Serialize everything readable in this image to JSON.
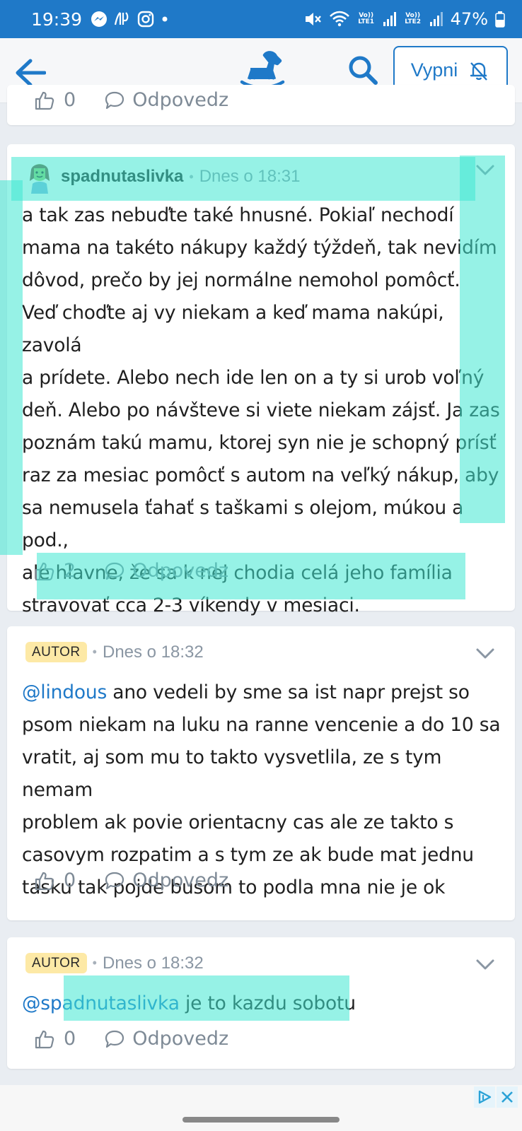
{
  "status_bar": {
    "time": "19:39",
    "network1": "Vo)) LTE1",
    "network2": "Vo)) LTE2",
    "battery": "47%"
  },
  "app_bar": {
    "mute_button_label": "Vypni"
  },
  "top_card": {
    "like_count": "0",
    "reply_label": "Odpovedz"
  },
  "comments": [
    {
      "username": "spadnutaslivka",
      "time": "Dnes o 18:31",
      "lines": [
        "a tak zas nebuďte také hnusné. Pokiaľ nechodí",
        "mama na takéto nákupy každý týždeň, tak nevidím",
        "dôvod, prečo by jej normálne nemohol pomôcť.",
        "Veď choďte aj vy niekam a keď mama nakúpi, zavolá",
        "a prídete. Alebo nech ide len on a ty si urob voľný",
        "deň. Alebo po návšteve si viete niekam zájsť. Ja zas",
        "poznám takú mamu, ktorej syn nie je schopný prísť",
        "raz za mesiac pomôcť s autom na veľký nákup, aby",
        "sa nemusela ťahať s taškami s olejom, múkou a pod.,",
        "ale hlavne, že sa k nej chodia celá jeho família",
        "stravovať cca 2-3 víkendy v mesiaci."
      ],
      "likes": "2",
      "reply_label": "Odpovedz"
    },
    {
      "badge": "AUTOR",
      "time": "Dnes o 18:32",
      "mention": "@lindous",
      "first_line_rest": " ano vedeli by sme sa ist napr prejst so",
      "lines": [
        "psom niekam na luku na ranne vencenie a do 10 sa",
        "vratit, aj som mu to takto vysvetlila, ze s tym nemam",
        "problem ak povie orientacny cas ale ze takto s",
        "casovym rozpatim a s tym ze ak bude mat jednu",
        "tasku tak pojde busom to podla mna nie je ok"
      ],
      "likes": "0",
      "reply_label": "Odpovedz"
    },
    {
      "badge": "AUTOR",
      "time": "Dnes o 18:32",
      "mention": "@spadnutaslivka",
      "text": " je to kazdu sobotu",
      "likes": "0",
      "reply_label": "Odpovedz"
    }
  ],
  "colors": {
    "brand_blue": "#1f79c8",
    "highlight": "#40e8d2",
    "autor_badge": "#fde9a6"
  }
}
